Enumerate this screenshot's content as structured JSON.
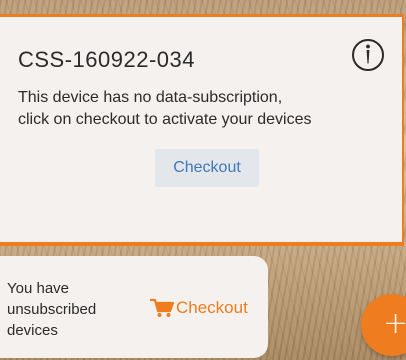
{
  "device_card": {
    "title": "CSS-160922-034",
    "message_line1": "This device has no data-subscription,",
    "message_line2": "click on checkout to activate your devices",
    "checkout_label": "Checkout",
    "info_icon": "info-icon"
  },
  "banner": {
    "line1": "You have",
    "line2": "unsubscribed",
    "line3": "devices",
    "checkout_label": "Checkout",
    "cart_icon": "cart-icon"
  },
  "fab": {
    "label": "+",
    "icon": "plus-icon"
  },
  "colors": {
    "accent": "#ef7d1f",
    "link": "#3f79b8",
    "card_bg": "#f4f1ee",
    "button_bg": "#e3e6ea",
    "text": "#2b2b2b"
  }
}
